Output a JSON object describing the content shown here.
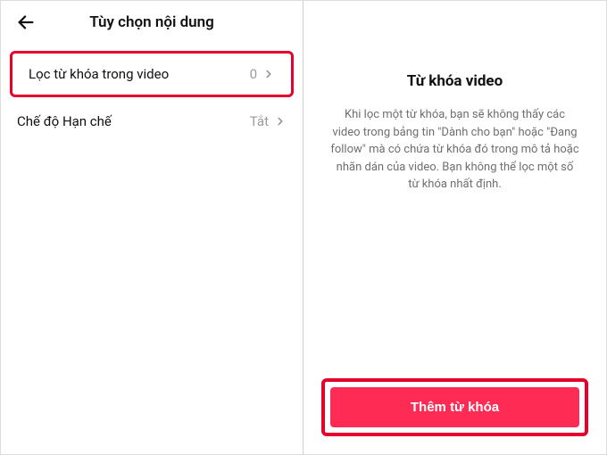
{
  "left": {
    "title": "Tùy chọn nội dung",
    "rows": [
      {
        "label": "Lọc từ khóa trong video",
        "value": "0"
      },
      {
        "label": "Chế độ Hạn chế",
        "value": "Tắt"
      }
    ]
  },
  "right": {
    "title": "Từ khóa video",
    "description": "Khi lọc một từ khóa, bạn sẽ không thấy các video trong bảng tin \"Dành cho bạn\" hoặc \"Đang follow\" mà có chứa từ khóa đó trong mô tả hoặc nhãn dán của video. Bạn không thể lọc một số từ khóa nhất định.",
    "button": "Thêm từ khóa"
  },
  "colors": {
    "accent": "#fe2c55",
    "highlight": "#e4002b"
  }
}
